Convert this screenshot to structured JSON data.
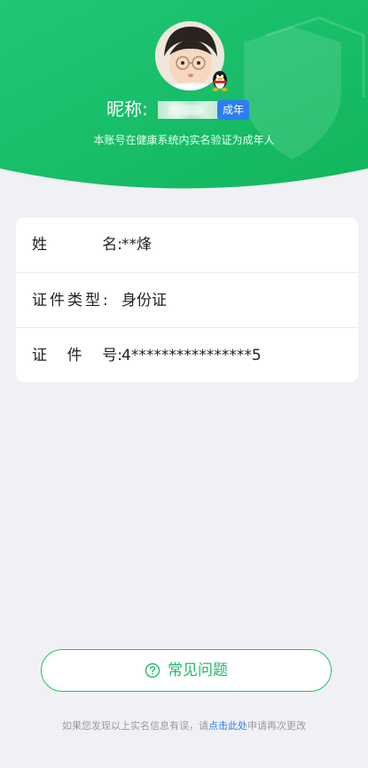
{
  "header": {
    "nickname_label": "昵称:",
    "adult_badge": "成年",
    "verify_text": "本账号在健康系统内实名验证为成年人",
    "colors": {
      "green_start": "#20c272",
      "green_end": "#12b95f"
    }
  },
  "identity": {
    "rows": [
      {
        "label_chars": [
          "姓",
          "名:"
        ],
        "value": "**烽"
      },
      {
        "label_chars": [
          "证件类型:"
        ],
        "value": "身份证"
      },
      {
        "label_chars": [
          "证",
          "件",
          "号:"
        ],
        "value": "4****************5"
      }
    ]
  },
  "faq": {
    "icon": "question-circle-icon",
    "label": "常见问题"
  },
  "footer": {
    "prefix": "如果您发现以上实名信息有误，请",
    "link": "点击此处",
    "suffix": "申请再次更改"
  },
  "accent_color": "#22c06d",
  "link_color": "#2d7ef5"
}
